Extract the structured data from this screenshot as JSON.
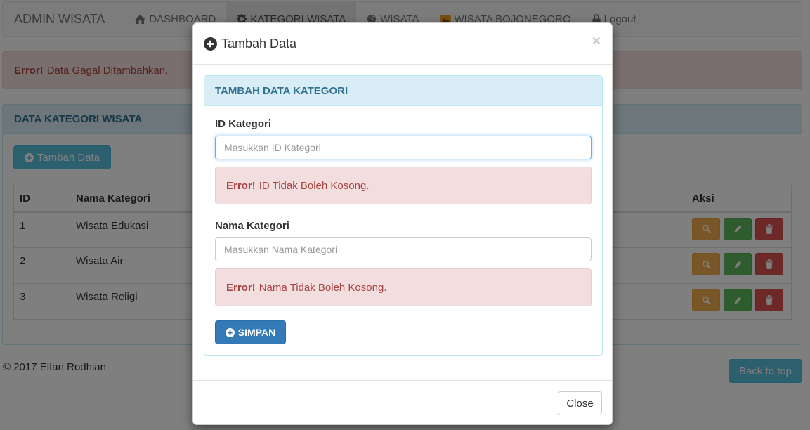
{
  "navbar": {
    "brand": "ADMIN WISATA",
    "items": [
      {
        "label": "DASHBOARD",
        "icon": "home-icon"
      },
      {
        "label": "KATEGORI WISATA",
        "icon": "gear-icon",
        "active": true
      },
      {
        "label": "WISATA",
        "icon": "globe-icon"
      },
      {
        "label": "WISATA BOJONEGORO",
        "icon": "map-icon"
      },
      {
        "label": "Logout",
        "icon": "lock-icon"
      }
    ]
  },
  "alert": {
    "strong": "Error!",
    "message": "Data Gagal Ditambahkan."
  },
  "panel": {
    "title": "DATA KATEGORI WISATA",
    "add_button": "Tambah Data",
    "table": {
      "headers": [
        "ID",
        "Nama Kategori",
        "Aksi"
      ],
      "rows": [
        {
          "id": "1",
          "name": "Wisata Edukasi"
        },
        {
          "id": "2",
          "name": "Wisata Air"
        },
        {
          "id": "3",
          "name": "Wisata Religi"
        }
      ]
    }
  },
  "footer": {
    "copyright": "© 2017 Elfan Rodhian",
    "back_to_top": "Back to top"
  },
  "modal": {
    "title": "Tambah Data",
    "close_x": "×",
    "panel_title": "TAMBAH DATA KATEGORI",
    "id_label": "ID Kategori",
    "id_placeholder": "Masukkan ID Kategori",
    "id_value": "",
    "id_error_strong": "Error!",
    "id_error": "ID Tidak Boleh Kosong.",
    "name_label": "Nama Kategori",
    "name_placeholder": "Masukkan Nama Kategori",
    "name_value": "",
    "name_error_strong": "Error!",
    "name_error": "Nama Tidak Boleh Kosong.",
    "save_button": "SIMPAN",
    "close_button": "Close"
  },
  "colors": {
    "info_bg": "#d9edf7",
    "info_text": "#31708f",
    "danger_bg": "#f2dede",
    "danger_text": "#a94442",
    "primary": "#337ab7",
    "btn_info": "#5bc0de",
    "btn_warning": "#f0ad4e",
    "btn_success": "#5cb85c",
    "btn_danger": "#d9534f"
  }
}
